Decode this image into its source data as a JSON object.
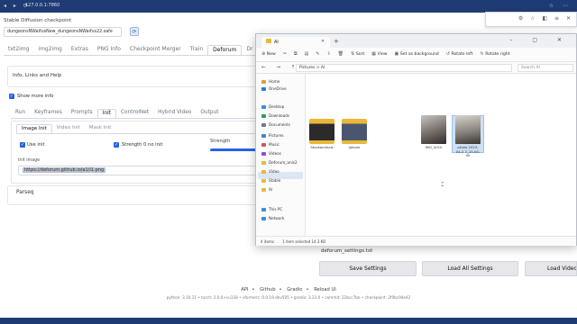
{
  "browser": {
    "url": "127.0.0.1:7860"
  },
  "webui": {
    "checkpoint_label": "Stable Diffusion checkpoint",
    "checkpoint_value": "dungeonsNWaifusNew_dungeonsNWaifus22.safe",
    "main_tabs": [
      "txt2img",
      "img2img",
      "Extras",
      "PNG Info",
      "Checkpoint Merger",
      "Train",
      "Deforum",
      "Dr"
    ],
    "info_panel": "Info, Links and Help",
    "show_more_info": "Show more info",
    "sub_tabs": [
      "Run",
      "Keyframes",
      "Prompts",
      "Init",
      "ControlNet",
      "Hybrid Video",
      "Output"
    ],
    "init_tabs": [
      "Image Init",
      "Video Init",
      "Mask Init"
    ],
    "use_init": "Use init",
    "strength_no_init": "Strength 0 no init",
    "strength": "Strength",
    "init_image_label": "Init image",
    "init_image_value": "https://deforum.github.io/a1/I1.png",
    "parseq": "Parseq",
    "settings_file": "deforum_settings.txt",
    "save_settings": "Save Settings",
    "load_all_settings": "Load All Settings",
    "load_video_settings": "Load Video S",
    "footer_links": [
      "API",
      "Github",
      "Gradio",
      "Reload UI"
    ],
    "footer_version": "python: 3.10.11  •  torch: 2.0.0+cu118  •  xformers: 0.0.19.dev505  •  gradio: 3.23.0  •  commit: 22bcc7be  •  checkpoint: 2f0bc94e42"
  },
  "explorer": {
    "tab_title": "AI",
    "toolbar": {
      "new": "New",
      "sort": "Sort",
      "view": "View",
      "set_background": "Set as background",
      "rotate_left": "Rotate left",
      "rotate_right": "Rotate right"
    },
    "address": "Pictures  >  AI",
    "search_placeholder": "Search AI",
    "nav": {
      "home": "Home",
      "onedrive": "OneDrive",
      "desktop": "Desktop",
      "downloads": "Downloads",
      "documents": "Documents",
      "pictures": "Pictures",
      "music": "Music",
      "videos": "Videos",
      "deforum": "Deforum_anis2",
      "video": "Video",
      "stable": "Stable",
      "ai": "AI",
      "this_pc": "This PC",
      "network": "Network"
    },
    "files": [
      {
        "name": "Stockanimals",
        "kind": "folder"
      },
      {
        "name": "Iphone",
        "kind": "folder"
      },
      {
        "name": "IMG_4010",
        "kind": "photo"
      },
      {
        "name": "photo 2023-04-2 7_15-00-00",
        "kind": "photo"
      }
    ],
    "status": {
      "items": "4 items",
      "selected": "1 item selected  14.3 KB"
    }
  }
}
